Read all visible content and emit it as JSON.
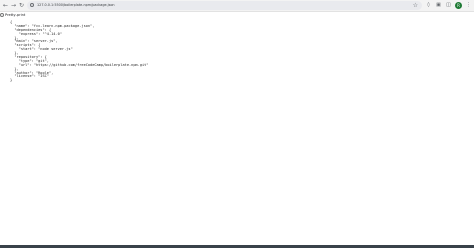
{
  "browser": {
    "url": "127.0.0.1:5500/boilerplate-npm/package.json",
    "back_icon": "arrow-left-icon",
    "forward_icon": "arrow-right-icon",
    "reload_icon": "reload-icon",
    "bookmark_icon": "star-icon",
    "profile_initial": "R"
  },
  "viewer": {
    "pretty_print_label": "Pretty-print",
    "pretty_print_checked": false
  },
  "json_lines": [
    "{",
    "  \"name\": \"fcc-learn-npm-package-json\",",
    "  \"dependencies\": {",
    "    \"express\": \"^4.14.0\"",
    "  },",
    "  \"main\": \"server.js\",",
    "  \"scripts\": {",
    "    \"start\": \"node server.js\"",
    "  },",
    "  \"repository\": {",
    "    \"type\": \"git\",",
    "    \"url\": \"https://github.com/freeCodeCamp/boilerplate-npm.git\"",
    "  },",
    "  \"author\": \"Roole\",",
    "  \"license\": \"ISC\"",
    "}"
  ],
  "colors": {
    "toolbar_bg": "#f3f3f3",
    "omnibox_bg": "#e9eaee",
    "taskbar_bg": "#39424a",
    "avatar_bg": "#1e7a34"
  }
}
